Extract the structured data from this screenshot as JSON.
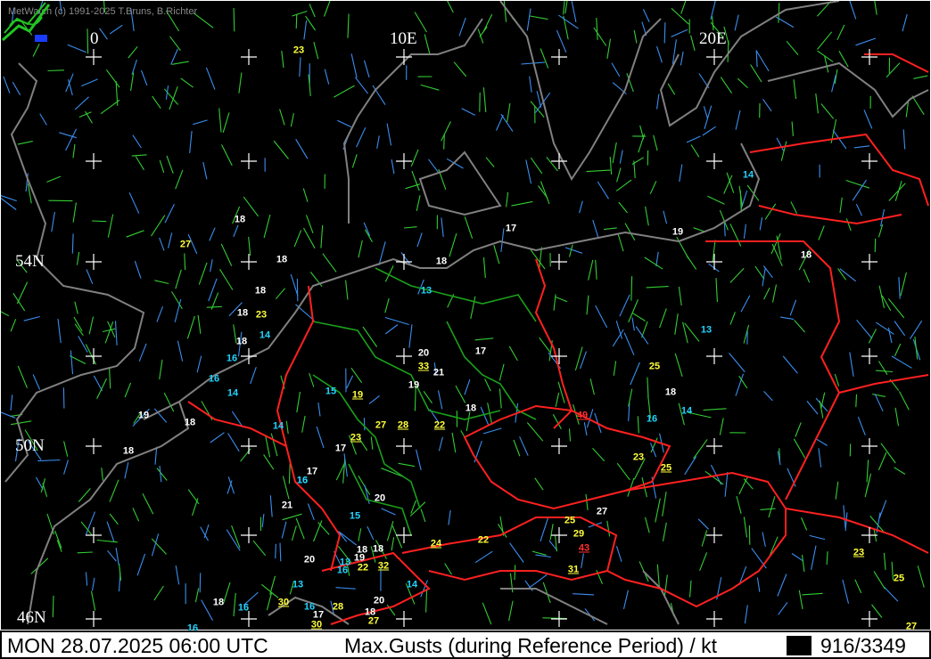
{
  "header": {
    "copyright": "MetWatch  (c) 1991-2025 T.Bruns, B.Richter"
  },
  "map": {
    "longitude_labels": [
      "0",
      "10E",
      "20E"
    ],
    "latitude_labels": [
      "54N",
      "50N",
      "46N"
    ],
    "colors": {
      "background": "#000000",
      "coastline": "#808080",
      "border_national": "#ff2020",
      "border_regional": "#1aa01a",
      "barb_green": "#33cc33",
      "barb_blue": "#3a8ef0",
      "grid": "#ffffff"
    },
    "gusts": [
      {
        "value": "23",
        "color": "yellowp"
      },
      {
        "value": "27",
        "color": "yellowp"
      },
      {
        "value": "18",
        "color": "white"
      },
      {
        "value": "18",
        "color": "white"
      },
      {
        "value": "18",
        "color": "white"
      },
      {
        "value": "18",
        "color": "white"
      },
      {
        "value": "23",
        "color": "yellowp"
      },
      {
        "value": "14",
        "color": "cyan"
      },
      {
        "value": "18",
        "color": "white"
      },
      {
        "value": "16",
        "color": "cyan"
      },
      {
        "value": "16",
        "color": "cyan"
      },
      {
        "value": "14",
        "color": "cyan"
      },
      {
        "value": "19",
        "color": "white"
      },
      {
        "value": "18",
        "color": "white"
      },
      {
        "value": "14",
        "color": "cyan"
      },
      {
        "value": "18",
        "color": "white"
      },
      {
        "value": "17",
        "color": "white"
      },
      {
        "value": "16",
        "color": "cyan"
      },
      {
        "value": "21",
        "color": "white"
      },
      {
        "value": "13",
        "color": "cyan"
      },
      {
        "value": "17",
        "color": "white"
      },
      {
        "value": "18",
        "color": "white"
      },
      {
        "value": "19",
        "color": "white"
      },
      {
        "value": "14",
        "color": "cyan"
      },
      {
        "value": "18",
        "color": "white"
      },
      {
        "value": "13",
        "color": "cyan"
      },
      {
        "value": "20",
        "color": "white"
      },
      {
        "value": "33",
        "color": "yellow"
      },
      {
        "value": "21",
        "color": "white"
      },
      {
        "value": "17",
        "color": "white"
      },
      {
        "value": "19",
        "color": "white"
      },
      {
        "value": "15",
        "color": "cyan"
      },
      {
        "value": "19",
        "color": "yellow"
      },
      {
        "value": "18",
        "color": "white"
      },
      {
        "value": "27",
        "color": "yellowp"
      },
      {
        "value": "28",
        "color": "yellow"
      },
      {
        "value": "22",
        "color": "yellow"
      },
      {
        "value": "23",
        "color": "yellow"
      },
      {
        "value": "17",
        "color": "white"
      },
      {
        "value": "16",
        "color": "cyan"
      },
      {
        "value": "25",
        "color": "yellowp"
      },
      {
        "value": "18",
        "color": "white"
      },
      {
        "value": "49",
        "color": "red"
      },
      {
        "value": "16",
        "color": "cyan"
      },
      {
        "value": "14",
        "color": "cyan"
      },
      {
        "value": "23",
        "color": "yellowp"
      },
      {
        "value": "25",
        "color": "yellow"
      },
      {
        "value": "20",
        "color": "white"
      },
      {
        "value": "15",
        "color": "cyan"
      },
      {
        "value": "18",
        "color": "white"
      },
      {
        "value": "18",
        "color": "white"
      },
      {
        "value": "24",
        "color": "yellow"
      },
      {
        "value": "22",
        "color": "yellowp"
      },
      {
        "value": "27",
        "color": "white"
      },
      {
        "value": "25",
        "color": "yellowp"
      },
      {
        "value": "29",
        "color": "yellowp"
      },
      {
        "value": "43",
        "color": "red"
      },
      {
        "value": "20",
        "color": "white"
      },
      {
        "value": "13",
        "color": "cyan"
      },
      {
        "value": "19",
        "color": "white"
      },
      {
        "value": "16",
        "color": "cyan"
      },
      {
        "value": "22",
        "color": "yellowp"
      },
      {
        "value": "32",
        "color": "yellow"
      },
      {
        "value": "31",
        "color": "yellow"
      },
      {
        "value": "13",
        "color": "cyan"
      },
      {
        "value": "14",
        "color": "cyan"
      },
      {
        "value": "30",
        "color": "yellow"
      },
      {
        "value": "16",
        "color": "cyan"
      },
      {
        "value": "17",
        "color": "white"
      },
      {
        "value": "28",
        "color": "yellowp"
      },
      {
        "value": "20",
        "color": "white"
      },
      {
        "value": "18",
        "color": "white"
      },
      {
        "value": "27",
        "color": "yellowp"
      },
      {
        "value": "30",
        "color": "yellow"
      },
      {
        "value": "18",
        "color": "white"
      },
      {
        "value": "16",
        "color": "cyan"
      },
      {
        "value": "16",
        "color": "cyan"
      },
      {
        "value": "23",
        "color": "yellow"
      },
      {
        "value": "25",
        "color": "yellowp"
      },
      {
        "value": "27",
        "color": "yellowp"
      }
    ]
  },
  "status_bar": {
    "datetime": "MON 28.07.2025 06:00 UTC",
    "parameter": "Max.Gusts (during Reference Period) / kt",
    "count": "916/3349"
  }
}
